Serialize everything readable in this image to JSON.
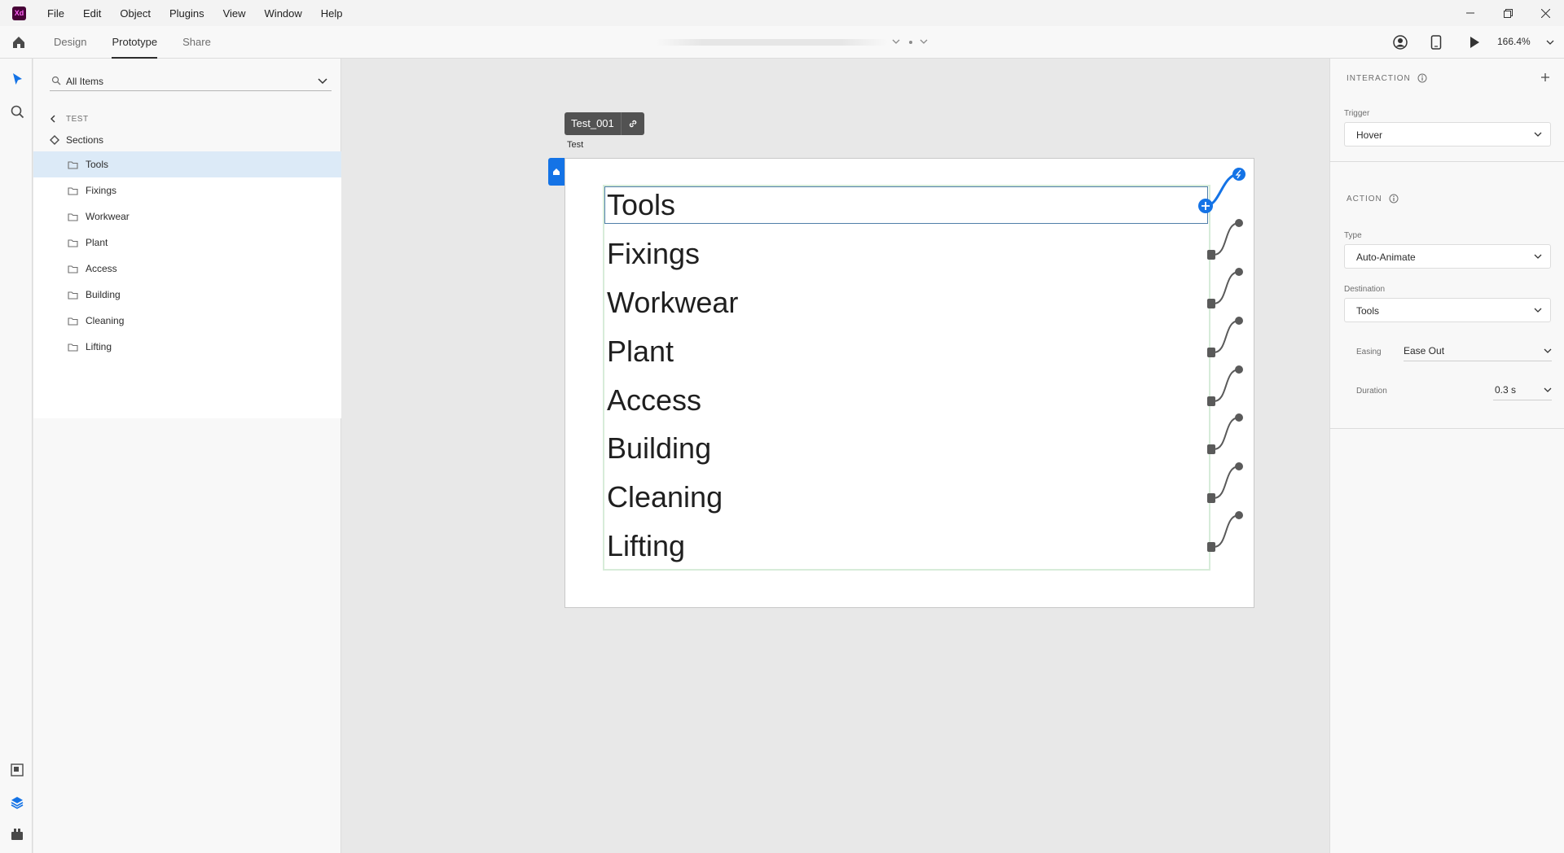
{
  "app": {
    "logo_text": "Xd"
  },
  "menu": [
    "File",
    "Edit",
    "Object",
    "Plugins",
    "View",
    "Window",
    "Help"
  ],
  "toolbar": {
    "tabs": [
      "Design",
      "Prototype",
      "Share"
    ],
    "active_tab": "Prototype",
    "zoom": "166.4%"
  },
  "layers": {
    "search_placeholder": "All Items",
    "breadcrumb": "TEST",
    "section_name": "Sections",
    "items": [
      "Tools",
      "Fixings",
      "Workwear",
      "Plant",
      "Access",
      "Building",
      "Cleaning",
      "Lifting"
    ],
    "selected_item": "Tools"
  },
  "canvas": {
    "artboard_tag": "Test_001",
    "artboard_label": "Test",
    "items": [
      "Tools",
      "Fixings",
      "Workwear",
      "Plant",
      "Access",
      "Building",
      "Cleaning",
      "Lifting"
    ]
  },
  "inspector": {
    "interaction_heading": "INTERACTION",
    "trigger_label": "Trigger",
    "trigger_value": "Hover",
    "action_heading": "ACTION",
    "type_label": "Type",
    "type_value": "Auto-Animate",
    "destination_label": "Destination",
    "destination_value": "Tools",
    "easing_label": "Easing",
    "easing_value": "Ease Out",
    "duration_label": "Duration",
    "duration_value": "0.3 s"
  },
  "colors": {
    "accent": "#1473e6",
    "selection": "#dceaf7",
    "wire": "#5a5a5a",
    "group_outline": "#d7ecd9"
  }
}
